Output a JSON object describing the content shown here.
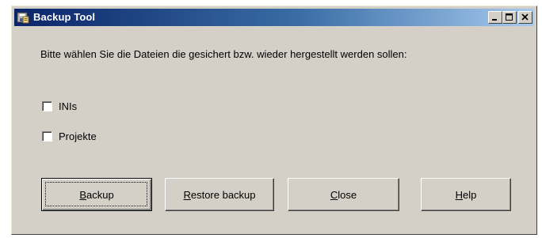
{
  "window": {
    "title": "Backup Tool",
    "app_icon": "backup-disk-icon",
    "caption_buttons": [
      "minimize-icon",
      "maximize-icon",
      "close-icon"
    ]
  },
  "prompt": "Bitte wählen Sie die Dateien die gesichert bzw. wieder hergestellt werden sollen:",
  "options": [
    {
      "label": "INIs",
      "checked": false
    },
    {
      "label": "Projekte",
      "checked": false
    }
  ],
  "buttons": {
    "backup": {
      "mnemonic": "B",
      "rest": "ackup"
    },
    "restore": {
      "mnemonic": "R",
      "rest": "estore backup"
    },
    "close": {
      "mnemonic": "C",
      "rest": "lose"
    },
    "help": {
      "mnemonic": "H",
      "rest": "elp"
    }
  },
  "colors": {
    "titlebar_start": "#0a246a",
    "titlebar_end": "#a6caf0",
    "face": "#d4d0c8"
  }
}
